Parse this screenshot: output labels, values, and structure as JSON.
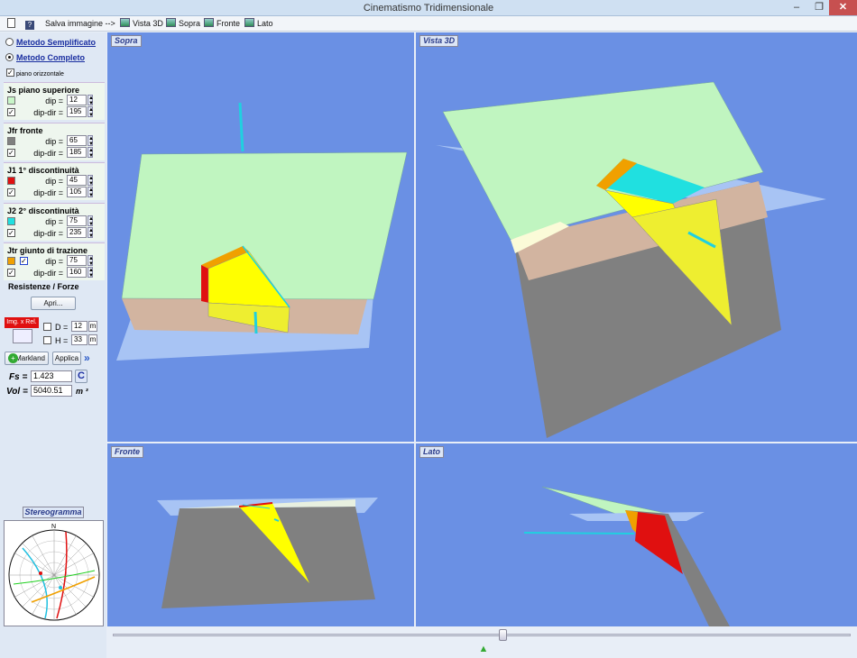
{
  "window": {
    "title": "Cinematismo Tridimensionale",
    "minimize": "–",
    "maximize": "❐",
    "close": "✕"
  },
  "toolbar": {
    "save_label": "Salva immagine -->",
    "items": [
      "Vista 3D",
      "Sopra",
      "Fronte",
      "Lato"
    ]
  },
  "method": {
    "simple": "Metodo Semplificato",
    "complete": "Metodo Completo",
    "selected": "complete",
    "horizontal_plane": "piano orizzontale"
  },
  "planes": [
    {
      "title": "Js piano superiore",
      "color": "#c8f5c8",
      "dip": "12",
      "dip_dir": "195"
    },
    {
      "title": "Jfr fronte",
      "color": "#808080",
      "dip": "65",
      "dip_dir": "185"
    },
    {
      "title": "J1  1° discontinuità",
      "color": "#e01010",
      "dip": "45",
      "dip_dir": "105"
    },
    {
      "title": "J2  2° discontinuità",
      "color": "#20e0e0",
      "dip": "75",
      "dip_dir": "235"
    },
    {
      "title": "Jtr  giunto di trazione",
      "color": "#f0a000",
      "dip": "75",
      "dip_dir": "160"
    }
  ],
  "labels": {
    "dip": "dip =",
    "dip_dir": "dip-dir =",
    "spin": "▲▼"
  },
  "forces": {
    "title": "Resistenze / Forze",
    "open_button": "Apri..."
  },
  "image": {
    "badge": "Img. x Rel.",
    "d_label": "D =",
    "d_value": "12",
    "h_label": "H =",
    "h_value": "33",
    "unit": "m"
  },
  "actions": {
    "markland": "Markland",
    "apply": "Applica",
    "c_button": "C"
  },
  "results": {
    "fs_label": "Fs =",
    "fs_value": "1.423",
    "vol_label": "Vol =",
    "vol_value": "5040.51",
    "vol_unit": "m ³"
  },
  "viewports": {
    "top": "Sopra",
    "view3d": "Vista 3D",
    "front": "Fronte",
    "side": "Lato"
  },
  "stereo": {
    "title": "Stereogramma",
    "north": "N"
  },
  "colors": {
    "viewport_bg": "#6a90e4",
    "top_plane": "#c0f5c0",
    "face": "#d2b4a0",
    "grey": "#808080",
    "wedge": "#ffff00"
  }
}
